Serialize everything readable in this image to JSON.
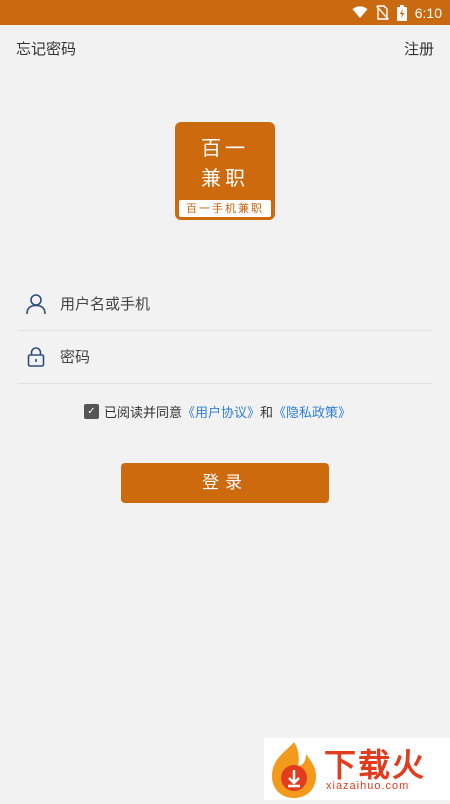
{
  "status_bar": {
    "time": "6:10",
    "background_color": "#c96a10",
    "icons": [
      "wifi-icon",
      "no-sim-icon",
      "battery-charging-icon"
    ]
  },
  "header": {
    "forgot_password": "忘记密码",
    "register": "注册"
  },
  "logo": {
    "line1": "百一",
    "line2": "兼职",
    "tagline": "百一手机兼职",
    "brand_color": "#cd6a0e"
  },
  "form": {
    "username_placeholder": "用户名或手机",
    "username_value": "",
    "password_placeholder": "密码",
    "password_value": "",
    "username_icon": "user-icon",
    "password_icon": "lock-icon"
  },
  "agreement": {
    "checked": true,
    "prefix": "已阅读并同意",
    "user_agreement": "《用户协议》",
    "conjunction": "和",
    "privacy_policy": "《隐私政策》",
    "link_color": "#2f7fd8"
  },
  "login_button": {
    "label": "登录"
  },
  "watermark": {
    "title": "下载火",
    "url": "xiazaihuo.com",
    "color": "#e33b1d"
  }
}
